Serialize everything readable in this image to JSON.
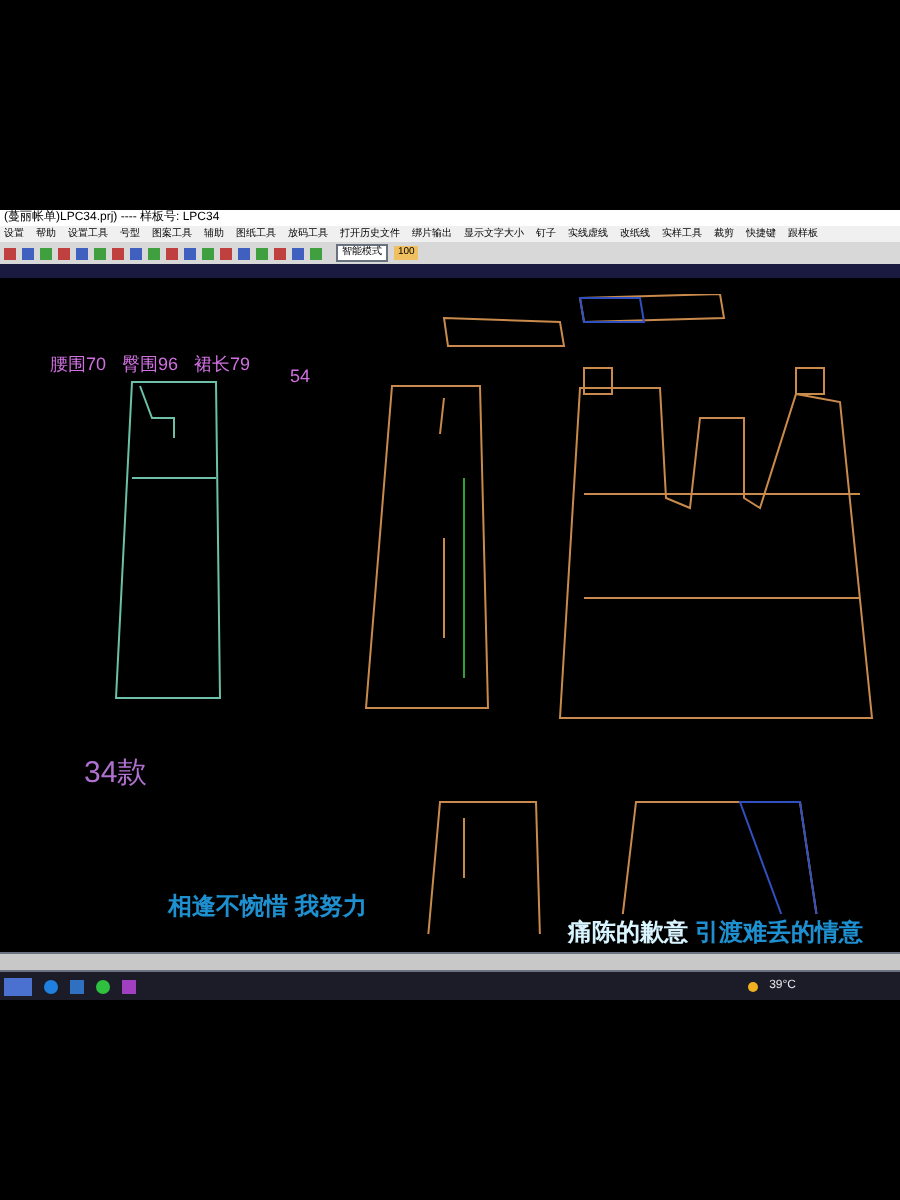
{
  "window": {
    "title": "(蔓丽帐单)LPC34.prj) ---- 样板号: LPC34"
  },
  "menu": [
    "设置",
    "帮助",
    "设置工具",
    "号型",
    "图案工具",
    "辅助",
    "图纸工具",
    "放码工具",
    "打开历史文件",
    "绑片输出",
    "显示文字大小",
    "钉子",
    "实线虚线",
    "改纸线",
    "实样工具",
    "裁剪",
    "快捷键",
    "跟样板"
  ],
  "toolbar": {
    "mode": "智能模式",
    "zoom": "100"
  },
  "canvas": {
    "labels": [
      {
        "kind": "measure",
        "text": "腰围70"
      },
      {
        "kind": "measure",
        "text": "臀围96"
      },
      {
        "kind": "measure",
        "text": "裙长79"
      },
      {
        "kind": "measure",
        "text": "54"
      },
      {
        "kind": "style",
        "text": "34款"
      }
    ]
  },
  "captions": [
    {
      "kind": "left",
      "text": "相逢不惋惜 我努力"
    },
    {
      "kind": "right",
      "parts": [
        "痛陈的歉意",
        "引渡难丢的情意"
      ]
    }
  ],
  "taskbar": {
    "weather": "39°C"
  }
}
